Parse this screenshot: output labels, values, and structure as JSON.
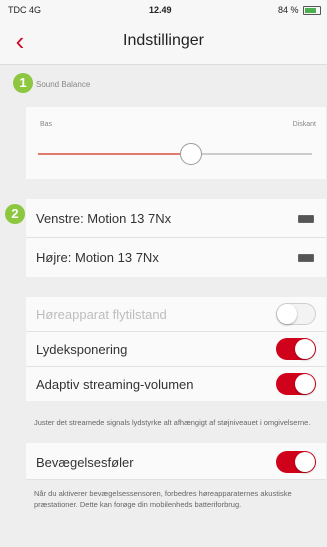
{
  "status_bar": {
    "carrier": "TDC 4G",
    "time": "12.49",
    "battery": "84 %"
  },
  "nav": {
    "back_icon": "chevron-left-icon",
    "title": "Indstillinger"
  },
  "badges": {
    "first": "1",
    "second": "2"
  },
  "sound_balance": {
    "header": "Sound Balance",
    "left_label": "Bas",
    "right_label": "Diskant",
    "value": 0.56
  },
  "devices": [
    {
      "label": "Venstre: Motion 13 7Nx"
    },
    {
      "label": "Højre: Motion 13 7Nx"
    }
  ],
  "settings": {
    "flight_mode": {
      "label": "Høreapparat flytilstand",
      "enabled": false,
      "on": false
    },
    "exposure": {
      "label": "Lydeksponering",
      "on": true
    },
    "adaptive": {
      "label": "Adaptiv streaming-volumen",
      "on": true,
      "description": "Juster det streamede signals lydstyrke alt afhængigt af støjniveauet i omgivelserne."
    },
    "motion_sensor": {
      "label": "Bevægelsesføler",
      "on": true,
      "description": "Når du aktiverer bevægelsessensoren, forbedres høreapparaternes akustiske præstationer. Dette kan forøge din mobilenheds batteriforbrug."
    }
  },
  "colors": {
    "accent": "#d0021b",
    "badge": "#8dc63f",
    "slider_fill": "#e07a6e"
  }
}
